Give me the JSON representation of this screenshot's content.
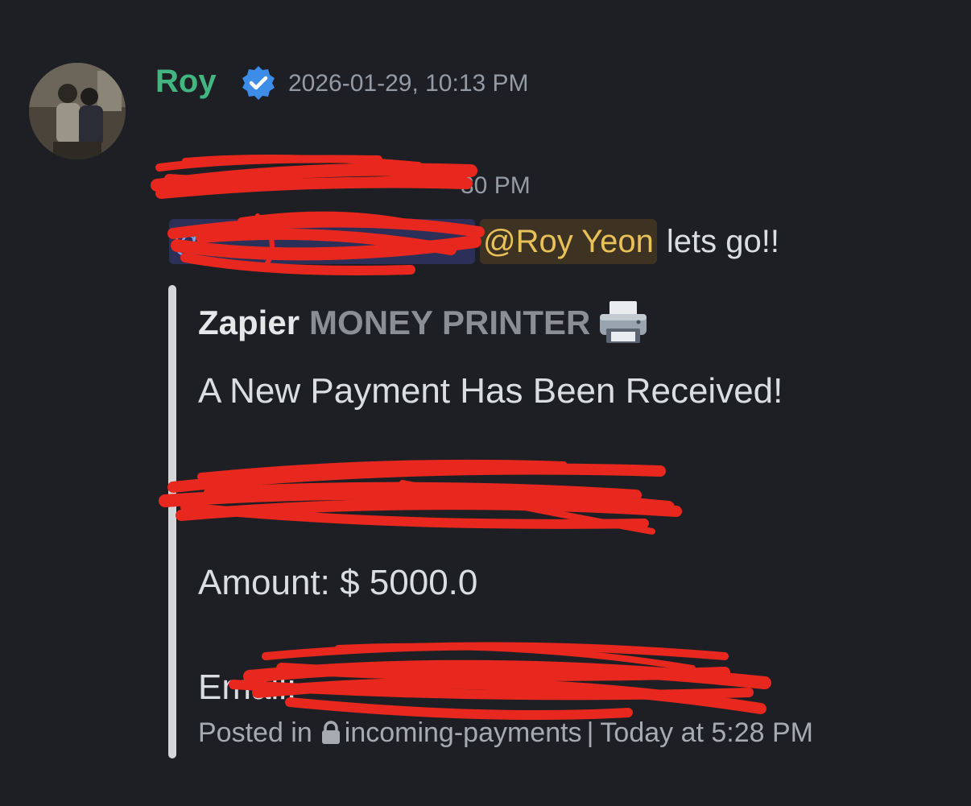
{
  "message": {
    "author": "Roy",
    "timestamp": "2026-01-29, 10:13 PM",
    "reply_time_visible": "30 PM",
    "mention_redacted": "@",
    "mention_user": "@Roy Yeon",
    "text": "lets go!!"
  },
  "embed": {
    "author_name": "Zapier",
    "author_desc": "MONEY PRINTER",
    "printer_icon": "printer-icon",
    "title": "A New Payment Has Been Received!",
    "amount": "Amount: $ 5000.0",
    "email_label": "Email:",
    "email_value": "",
    "footer": {
      "posted_in": "Posted in",
      "lock_icon": "lock-icon",
      "channel": "incoming-payments",
      "separator": "|",
      "time": "Today at 5:28 PM"
    }
  },
  "colors": {
    "background": "#1e1f24",
    "author": "#43b581",
    "mention_gold": "#e8c159",
    "redaction": "#e8281e"
  }
}
